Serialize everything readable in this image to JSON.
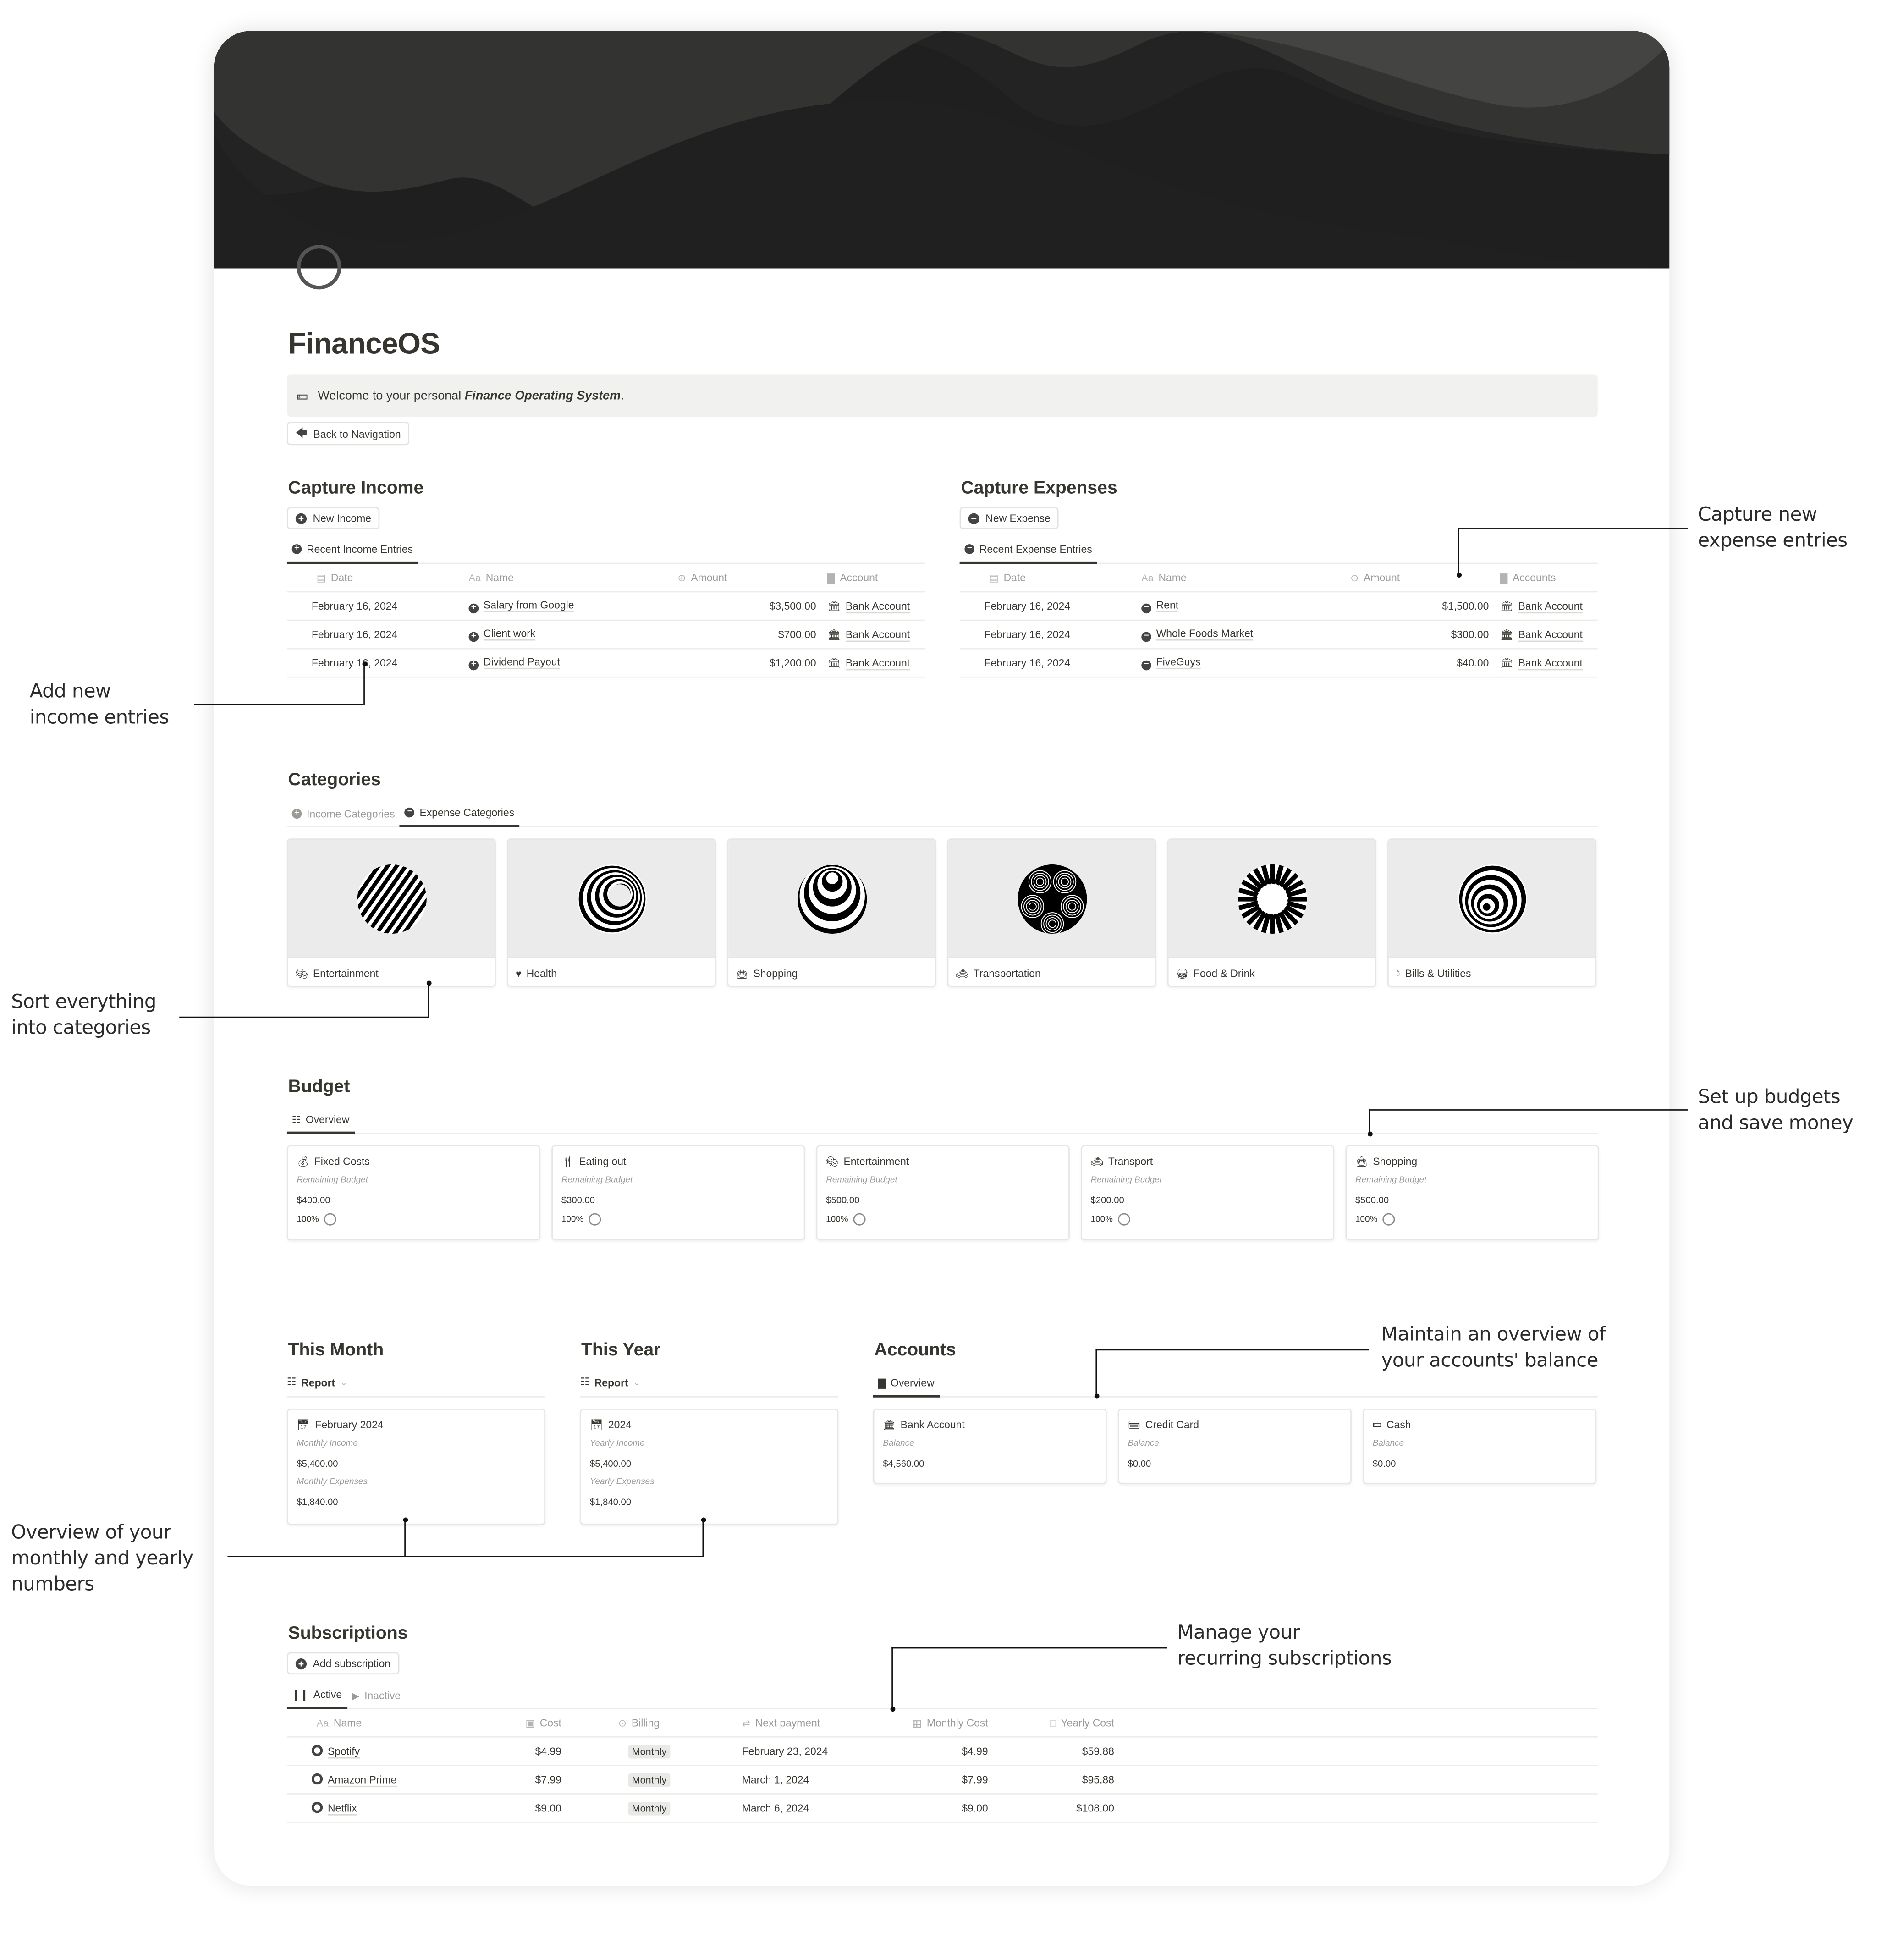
{
  "page": {
    "title": "FinanceOS",
    "callout_prefix": "Welcome to your personal ",
    "callout_emphasis": "Finance Operating System",
    "callout_suffix": ".",
    "back_button": "Back to Navigation"
  },
  "income": {
    "heading": "Capture Income",
    "new_button": "New Income",
    "tab": "Recent Income Entries",
    "columns": [
      "Date",
      "Name",
      "Amount",
      "Account"
    ],
    "rows": [
      {
        "date": "February 16, 2024",
        "name": "Salary from Google",
        "amount": "$3,500.00",
        "account": "Bank Account"
      },
      {
        "date": "February 16, 2024",
        "name": "Client work",
        "amount": "$700.00",
        "account": "Bank Account"
      },
      {
        "date": "February 16, 2024",
        "name": "Dividend Payout",
        "amount": "$1,200.00",
        "account": "Bank Account"
      }
    ]
  },
  "expenses": {
    "heading": "Capture Expenses",
    "new_button": "New Expense",
    "tab": "Recent Expense Entries",
    "columns": [
      "Date",
      "Name",
      "Amount",
      "Accounts"
    ],
    "rows": [
      {
        "date": "February 16, 2024",
        "name": "Rent",
        "amount": "$1,500.00",
        "account": "Bank Account"
      },
      {
        "date": "February 16, 2024",
        "name": "Whole Foods Market",
        "amount": "$300.00",
        "account": "Bank Account"
      },
      {
        "date": "February 16, 2024",
        "name": "FiveGuys",
        "amount": "$40.00",
        "account": "Bank Account"
      }
    ]
  },
  "categories": {
    "heading": "Categories",
    "tabs": [
      {
        "label": "Income Categories",
        "active": false
      },
      {
        "label": "Expense Categories",
        "active": true
      }
    ],
    "items": [
      {
        "label": "Entertainment",
        "icon": "theater-mask-icon"
      },
      {
        "label": "Health",
        "icon": "heart-pulse-icon"
      },
      {
        "label": "Shopping",
        "icon": "shopping-bag-icon"
      },
      {
        "label": "Transportation",
        "icon": "taxi-icon"
      },
      {
        "label": "Food & Drink",
        "icon": "fast-food-icon"
      },
      {
        "label": "Bills & Utilities",
        "icon": "water-drop-icon"
      }
    ]
  },
  "budget": {
    "heading": "Budget",
    "tab": "Overview",
    "remaining_label": "Remaining Budget",
    "items": [
      {
        "name": "Fixed Costs",
        "icon": "money-bag-icon",
        "remaining": "$400.00",
        "percent": "100%"
      },
      {
        "name": "Eating out",
        "icon": "fork-knife-icon",
        "remaining": "$300.00",
        "percent": "100%"
      },
      {
        "name": "Entertainment",
        "icon": "theater-mask-icon",
        "remaining": "$500.00",
        "percent": "100%"
      },
      {
        "name": "Transport",
        "icon": "taxi-icon",
        "remaining": "$200.00",
        "percent": "100%"
      },
      {
        "name": "Shopping",
        "icon": "shopping-bag-icon",
        "remaining": "$500.00",
        "percent": "100%"
      }
    ]
  },
  "this_month": {
    "heading": "This Month",
    "view": "Report",
    "card_title": "February 2024",
    "income_label": "Monthly Income",
    "income": "$5,400.00",
    "expenses_label": "Monthly Expenses",
    "expenses": "$1,840.00"
  },
  "this_year": {
    "heading": "This Year",
    "view": "Report",
    "card_title": "2024",
    "income_label": "Yearly Income",
    "income": "$5,400.00",
    "expenses_label": "Yearly Expenses",
    "expenses": "$1,840.00"
  },
  "accounts": {
    "heading": "Accounts",
    "tab": "Overview",
    "balance_label": "Balance",
    "items": [
      {
        "name": "Bank Account",
        "icon": "bank-icon",
        "balance": "$4,560.00"
      },
      {
        "name": "Credit Card",
        "icon": "credit-card-icon",
        "balance": "$0.00"
      },
      {
        "name": "Cash",
        "icon": "cash-icon",
        "balance": "$0.00"
      }
    ]
  },
  "subscriptions": {
    "heading": "Subscriptions",
    "add_button": "Add subscription",
    "tabs": [
      {
        "label": "Active",
        "active": true
      },
      {
        "label": "Inactive",
        "active": false
      }
    ],
    "columns": [
      "Name",
      "Cost",
      "Billing",
      "Next payment",
      "Monthly Cost",
      "Yearly Cost"
    ],
    "rows": [
      {
        "name": "Spotify",
        "cost": "$4.99",
        "billing": "Monthly",
        "next": "February 23, 2024",
        "monthly": "$4.99",
        "yearly": "$59.88"
      },
      {
        "name": "Amazon Prime",
        "cost": "$7.99",
        "billing": "Monthly",
        "next": "March 1, 2024",
        "monthly": "$7.99",
        "yearly": "$95.88"
      },
      {
        "name": "Netflix",
        "cost": "$9.00",
        "billing": "Monthly",
        "next": "March 6, 2024",
        "monthly": "$9.00",
        "yearly": "$108.00"
      }
    ]
  },
  "annotations": {
    "capture_expenses": [
      "Capture new",
      "expense entries"
    ],
    "add_income": [
      "Add new",
      "income entries"
    ],
    "categories": [
      "Sort everything",
      "into categories"
    ],
    "budgets": [
      "Set up budgets",
      "and save money"
    ],
    "accounts": [
      "Maintain an overview of",
      "your accounts' balance"
    ],
    "overview": [
      "Overview of your",
      "monthly and yearly",
      "numbers"
    ],
    "subscriptions": [
      "Manage your",
      "recurring subscriptions"
    ]
  }
}
